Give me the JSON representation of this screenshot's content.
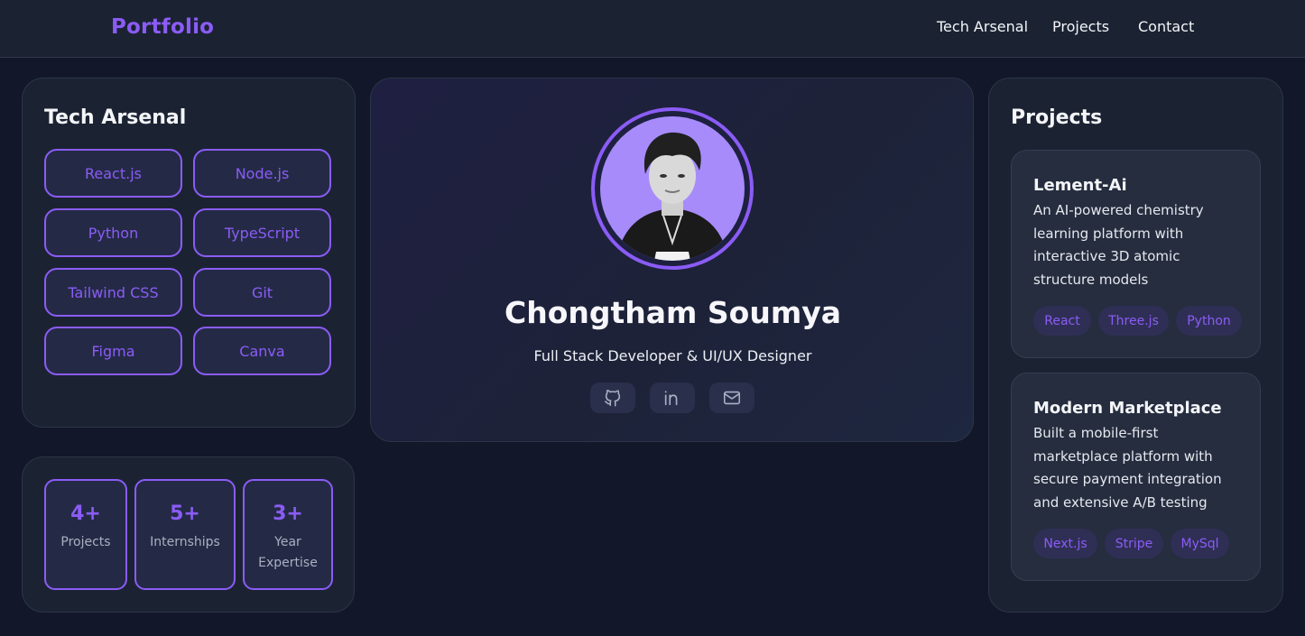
{
  "header": {
    "brand": "Portfolio",
    "nav": [
      "Tech Arsenal",
      "Projects",
      "Contact"
    ]
  },
  "tech_arsenal": {
    "title": "Tech Arsenal",
    "skills": [
      "React.js",
      "Node.js",
      "Python",
      "TypeScript",
      "Tailwind CSS",
      "Git",
      "Figma",
      "Canva"
    ]
  },
  "stats": [
    {
      "value": "4+",
      "label": "Projects"
    },
    {
      "value": "5+",
      "label": "Internships"
    },
    {
      "value": "3+",
      "label": "Year Expertise"
    }
  ],
  "profile": {
    "name": "Chongtham Soumya",
    "role": "Full Stack Developer & UI/UX Designer",
    "social_icons": [
      "github-icon",
      "linkedin-icon",
      "mail-icon"
    ]
  },
  "projects": {
    "title": "Projects",
    "items": [
      {
        "title": "Lement-Ai",
        "description": "An AI-powered chemistry learning platform with interactive 3D atomic structure models",
        "tags": [
          "React",
          "Three.js",
          "Python"
        ]
      },
      {
        "title": "Modern Marketplace",
        "description": "Built a mobile-first marketplace platform with secure payment integration and extensive A/B testing",
        "tags": [
          "Next.js",
          "Stripe",
          "MySql"
        ]
      }
    ]
  },
  "colors": {
    "accent": "#8b5cf6",
    "background": "#121829",
    "card": "#1b2333",
    "avatar_bg": "#a78bfa"
  }
}
